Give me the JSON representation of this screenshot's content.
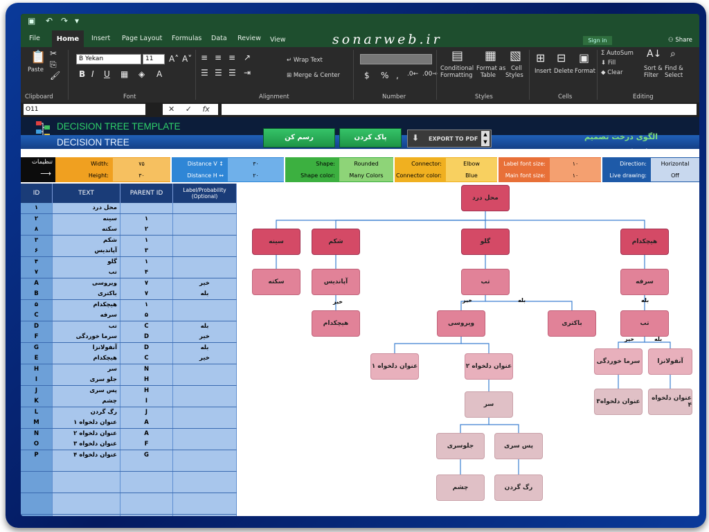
{
  "titlebar": {
    "share": "Share",
    "signin": "Sign in"
  },
  "brand": "sonarweb.ir",
  "tabs": [
    "File",
    "Home",
    "Insert",
    "Page Layout",
    "Formulas",
    "Data",
    "Review",
    "View"
  ],
  "ribbon": {
    "clipboard": {
      "paste": "Paste",
      "label": "Clipboard"
    },
    "font": {
      "name": "B Yekan",
      "size": "11",
      "label": "Font"
    },
    "alignment": {
      "wrap": "Wrap Text",
      "merge": "Merge & Center",
      "label": "Alignment"
    },
    "number": {
      "label": "Number"
    },
    "styles": {
      "cond": "Conditional",
      "cond2": "Formatting",
      "fmt": "Format as",
      "fmt2": "Table",
      "cell": "Cell",
      "cell2": "Styles",
      "label": "Styles"
    },
    "cells": {
      "insert": "Insert",
      "delete": "Delete",
      "format": "Format",
      "label": "Cells"
    },
    "editing": {
      "autosum": "AutoSum",
      "fill": "Fill",
      "clear": "Clear",
      "sort": "Sort &",
      "sort2": "Filter",
      "find": "Find &",
      "find2": "Select",
      "label": "Editing"
    }
  },
  "namebox": "O11",
  "header": {
    "title_en": "DECISION TREE TEMPLATE",
    "subtitle_en": "DECISION TREE",
    "title_fa": "الگوی درخت تصمیم",
    "subtitle_fa": "درخت تصمیم",
    "draw_btn": "رسم کن",
    "clear_btn": "پاک کردن",
    "pdf_btn": "EXPORT TO PDF"
  },
  "settings": {
    "label_fa": "تنظیمات",
    "width": {
      "label": "Width:",
      "value": "۷۵"
    },
    "height": {
      "label": "Height:",
      "value": "۳۰"
    },
    "dist_v": {
      "label": "Distance V ↕",
      "value": "۳۰"
    },
    "dist_h": {
      "label": "Distance H ↔",
      "value": "۲۰"
    },
    "shape": {
      "label": "Shape:",
      "value": "Rounded"
    },
    "shape_color": {
      "label": "Shape color:",
      "value": "Many Colors"
    },
    "connector": {
      "label": "Connector:",
      "value": "Elbow"
    },
    "connector_color": {
      "label": "Connector color:",
      "value": "Blue"
    },
    "label_font": {
      "label": "Label font size:",
      "value": "۱۰"
    },
    "main_font": {
      "label": "Main font size:",
      "value": "۱۰"
    },
    "direction": {
      "label": "Direction:",
      "value": "Horizontal"
    },
    "live": {
      "label": "Live drawing:",
      "value": "Off"
    }
  },
  "table": {
    "headers": [
      "ID",
      "TEXT",
      "PARENT ID",
      "Label/Probability (Optional)"
    ],
    "rows": [
      [
        "۱",
        "محل درد",
        "",
        ""
      ],
      [
        "۲",
        "سینه",
        "۱",
        ""
      ],
      [
        "۸",
        "سکته",
        "۲",
        ""
      ],
      [
        "۳",
        "شکم",
        "۱",
        ""
      ],
      [
        "۶",
        "آپاندیس",
        "۳",
        ""
      ],
      [
        "۴",
        "گلو",
        "۱",
        ""
      ],
      [
        "۷",
        "تب",
        "۴",
        ""
      ],
      [
        "A",
        "ویروسی",
        "۷",
        "خیر"
      ],
      [
        "B",
        "باکتری",
        "۷",
        "بله"
      ],
      [
        "۵",
        "هیچکدام",
        "۱",
        ""
      ],
      [
        "C",
        "سرفه",
        "۵",
        ""
      ],
      [
        "D",
        "تب",
        "C",
        "بله"
      ],
      [
        "F",
        "سرما خوردگی",
        "D",
        "خیر"
      ],
      [
        "G",
        "آنفولانزا",
        "D",
        "بله"
      ],
      [
        "E",
        "هیچکدام",
        "C",
        "خیر"
      ],
      [
        "H",
        "سر",
        "N",
        ""
      ],
      [
        "I",
        "جلو سری",
        "H",
        ""
      ],
      [
        "J",
        "پس سری",
        "H",
        ""
      ],
      [
        "K",
        "چشم",
        "I",
        ""
      ],
      [
        "L",
        "رگ گردن",
        "J",
        ""
      ],
      [
        "M",
        "عنوان دلخواه ۱",
        "A",
        ""
      ],
      [
        "N",
        "عنوان دلخواه ۲",
        "A",
        ""
      ],
      [
        "O",
        "عنوان دلخواه ۳",
        "F",
        ""
      ],
      [
        "P",
        "عنوان دلخواه ۴",
        "G",
        ""
      ]
    ]
  },
  "tree": {
    "root": "محل درد",
    "sine": "سینه",
    "shekam": "شکم",
    "galoo": "گلو",
    "hichkodam": "هیچکدام",
    "sekte": "سکته",
    "apandis": "آپاندیس",
    "tab1": "تب",
    "sorfe": "سرفه",
    "hichkodam2": "هیچکدام",
    "virusi": "ویروسی",
    "bakteri": "باکتری",
    "tab2": "تب",
    "onvan1": "عنوان دلخواه ۱",
    "onvan2": "عنوان دلخواه ۲",
    "sarmakhordegi": "سرما خوردگی",
    "anfolanza": "آنفولانزا",
    "sar": "سر",
    "onvan3": "عنوان دلخواه۳",
    "onvan4": "عنوان دلخواه ۴",
    "jelosari": "جلوسری",
    "passari": "پس سری",
    "cheshm": "چشم",
    "raggardan": "رگ گردن",
    "lbl_kheyr": "خیر",
    "lbl_bale": "بله"
  }
}
